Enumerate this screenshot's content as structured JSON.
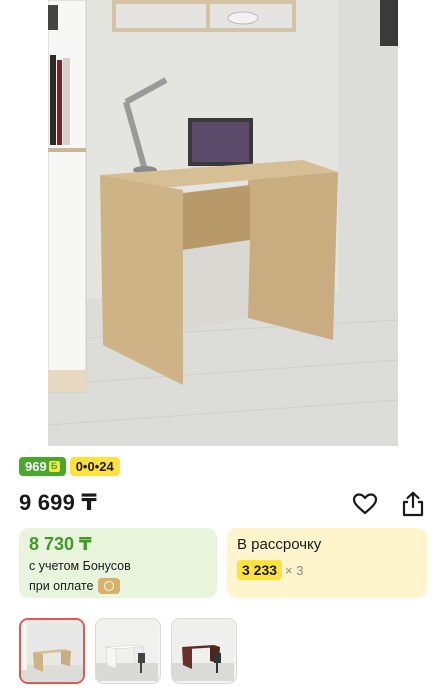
{
  "product": {
    "image_alt": "Письменный стол",
    "images_count": 3
  },
  "badges": {
    "bonus": "969",
    "bonus_icon": "Б",
    "credit": "0•0•24"
  },
  "price": {
    "value": "9 699 ₸"
  },
  "actions": {
    "favorite_icon": "heart-icon",
    "share_icon": "share-icon"
  },
  "bonus_card": {
    "price": "8 730 ₸",
    "line1": "с учетом Бонусов",
    "line2": "при оплате"
  },
  "installment_card": {
    "title": "В рассрочку",
    "amount": "3 233",
    "multiplier": "× 3"
  },
  "colors": {
    "accent_green": "#4aa72e",
    "accent_yellow": "#ffe23d",
    "active_thumb_border": "#e2584d"
  }
}
